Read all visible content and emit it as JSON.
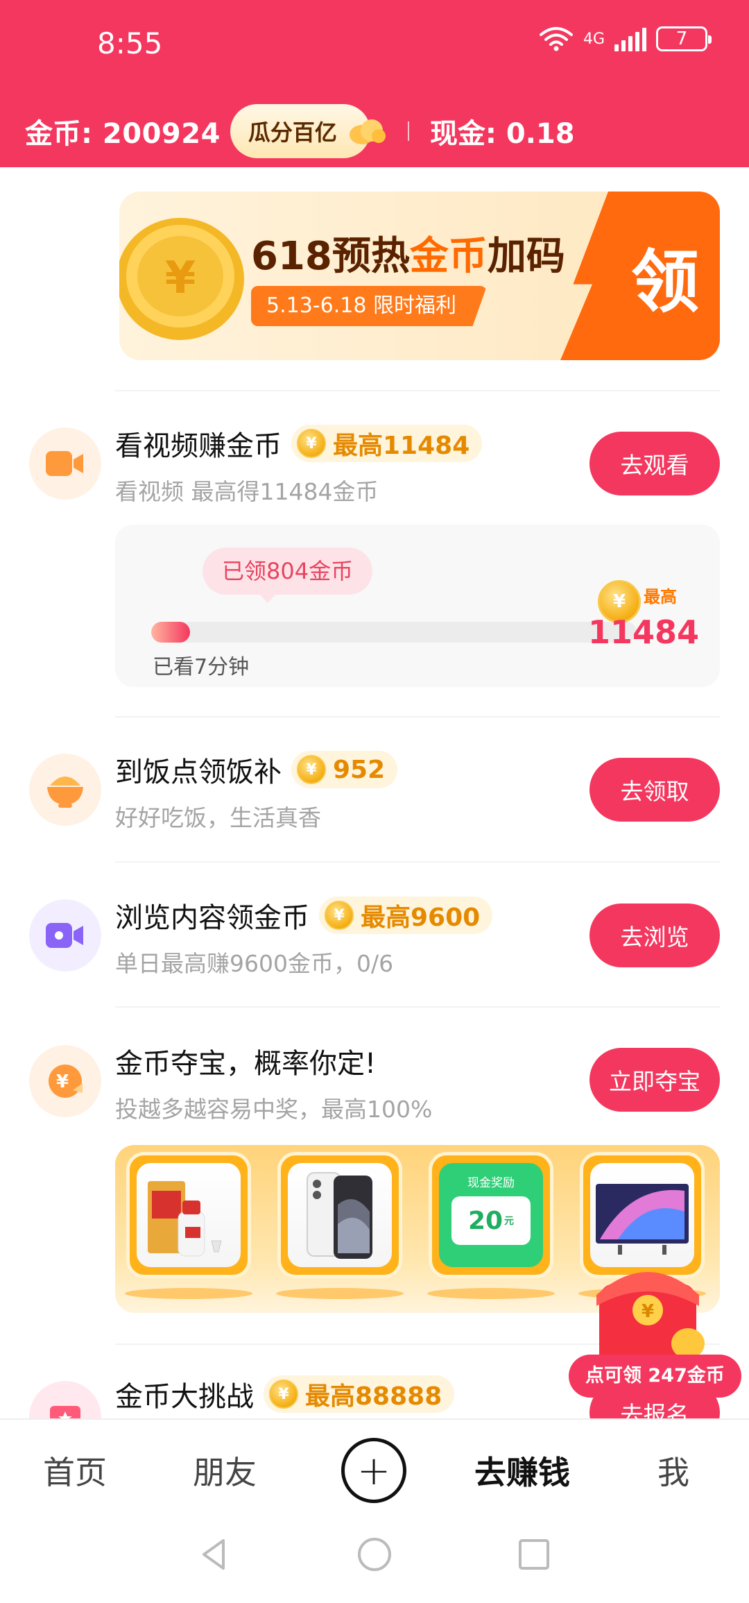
{
  "status_bar": {
    "time": "8:55",
    "network": "4G",
    "battery": "7"
  },
  "header": {
    "coins": "金币: 200924",
    "pill": "瓜分百亿",
    "cash": "现金: 0.18"
  },
  "banner": {
    "title_a": "618预热",
    "title_b": "金币",
    "title_c": "加码",
    "subtitle": "5.13-6.18 限时福利",
    "cta": "领"
  },
  "tasks": [
    {
      "title": "看视频赚金币",
      "reward": "最高11484",
      "sub": "看视频 最高得11484金币",
      "button": "去观看"
    },
    {
      "title": "到饭点领饭补",
      "reward": "952",
      "sub": "好好吃饭，生活真香",
      "button": "去领取"
    },
    {
      "title": "浏览内容领金币",
      "reward": "最高9600",
      "sub": "单日最高赚9600金币，0/6",
      "button": "去浏览"
    },
    {
      "title": "金币夺宝，概率你定!",
      "sub": "投越多越容易中奖，最高100%",
      "button": "立即夺宝"
    },
    {
      "title": "金币大挑战",
      "reward": "最高88888",
      "button": "去报名"
    }
  ],
  "video_progress": {
    "claimed": "已领804金币",
    "watched": "已看7分钟",
    "max_label": "最高",
    "max_value": "11484",
    "progress_fraction": 0.08
  },
  "prize_cards": [
    {
      "name": "liquor-gift-box"
    },
    {
      "name": "smartphone"
    },
    {
      "name": "cash-reward",
      "label": "现金奖励",
      "amount": "20",
      "unit": "元"
    },
    {
      "name": "television"
    }
  ],
  "floating_packet": {
    "label": "点可领 247金币"
  },
  "bottom_nav": {
    "home": "首页",
    "friends": "朋友",
    "plus": "+",
    "earn": "去赚钱",
    "me": "我"
  },
  "colors": {
    "brand": "#f4375f",
    "gold": "#e58a00",
    "banner_orange": "#ff6a0e"
  }
}
